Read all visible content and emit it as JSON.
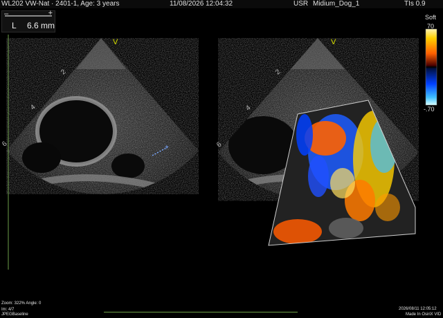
{
  "header": {
    "left_text": "WL202 VW-Nat · 2401-1, Age: 3 years",
    "datetime": "11/08/2026 12:04:32",
    "usr_label": "USR",
    "profile": "Midium_Dog_1",
    "tis": "TIs 0.9"
  },
  "measurement": {
    "minus_label": "–",
    "plus_label": "+",
    "label": "L",
    "value": "6.6 mm"
  },
  "depth_markers": {
    "left": [
      "2",
      "4",
      "6"
    ],
    "right": [
      "2",
      "4",
      "6"
    ],
    "orientation": "V"
  },
  "color_scale": {
    "title": "Soft",
    "max_label": "70",
    "min_label": "-.70",
    "colors": {
      "warm": "#ff9a00",
      "cold": "#1c5cff",
      "center": "#000000"
    }
  },
  "footer": {
    "zoom": "Zoom: 322% Angle: 0",
    "image_index": "Im: 4/7",
    "codec": "JPEGBaseline",
    "timestamp": "2026/08/11 12:05:12",
    "made_in": "Made In OsiriX VID"
  },
  "colors": {
    "marker_yellow": "#d8e000",
    "accent_green": "#6ea04a",
    "caliper_blue": "#7aa8ff"
  }
}
